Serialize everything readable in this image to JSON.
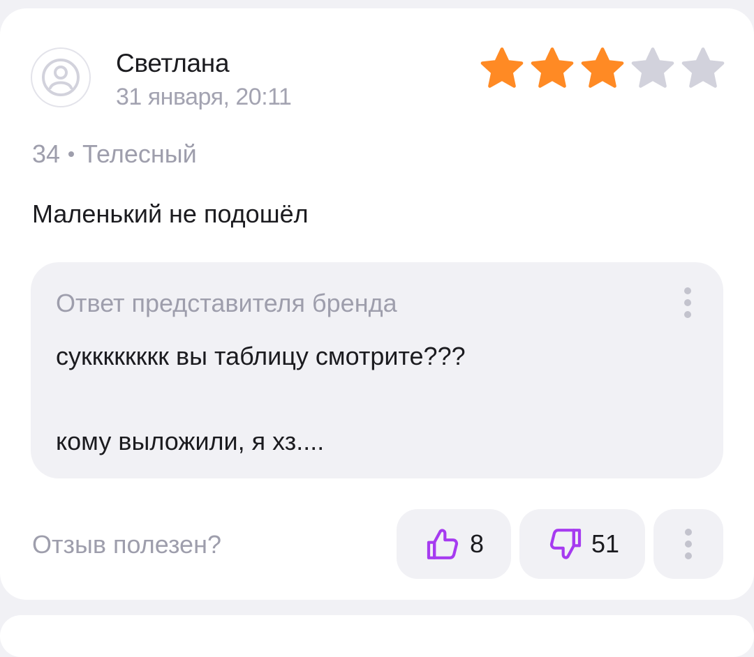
{
  "review": {
    "author": "Светлана",
    "date": "31 января, 20:11",
    "rating": 3,
    "rating_max": 5,
    "size": "34",
    "color": "Телесный",
    "text": "Маленький не подошёл"
  },
  "reply": {
    "title": "Ответ представителя бренда",
    "line1": "сукккккккк вы таблицу смотрите???",
    "line2": "кому выложили, я хз...."
  },
  "footer": {
    "helpful_question": "Отзыв полезен?",
    "likes": "8",
    "dislikes": "51"
  },
  "colors": {
    "star_filled": "#ff8a24",
    "star_empty": "#d2d2dc",
    "vote_icon": "#a63bf0"
  },
  "icons": {
    "avatar": "user-avatar-icon",
    "like": "thumbs-up-icon",
    "dislike": "thumbs-down-icon",
    "more": "more-vertical-icon"
  }
}
